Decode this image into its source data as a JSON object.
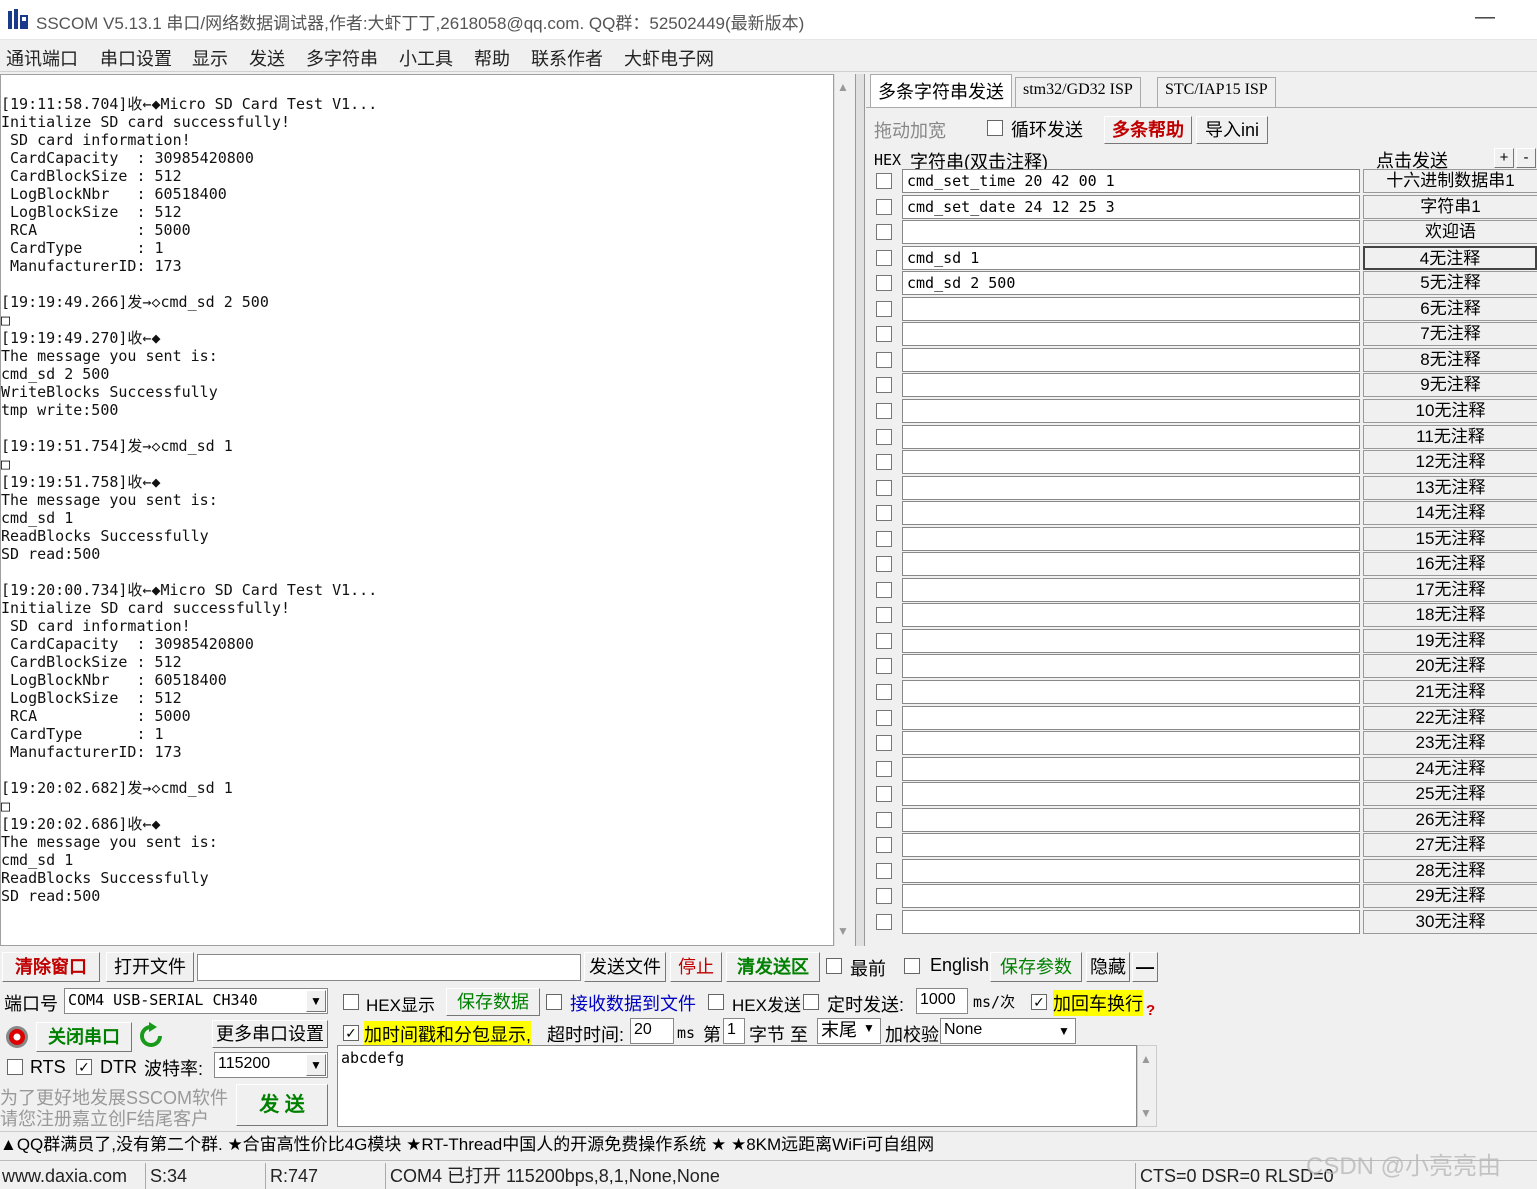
{
  "window": {
    "title": "SSCOM V5.13.1 串口/网络数据调试器,作者:大虾丁丁,2618058@qq.com. QQ群：52502449(最新版本)",
    "minimize_glyph": "—"
  },
  "menu": [
    "通讯端口",
    "串口设置",
    "显示",
    "发送",
    "多字符串",
    "小工具",
    "帮助",
    "联系作者",
    "大虾电子网"
  ],
  "receive_log": "[19:11:58.704]收←◆Micro SD Card Test V1...\nInitialize SD card successfully!\n SD card information!\n CardCapacity  : 30985420800\n CardBlockSize : 512\n LogBlockNbr   : 60518400\n LogBlockSize  : 512\n RCA           : 5000\n CardType      : 1\n ManufacturerID: 173\n\n[19:19:49.266]发→◇cmd_sd 2 500\n□\n[19:19:49.270]收←◆\nThe message you sent is:\ncmd_sd 2 500\nWriteBlocks Successfully\ntmp write:500\n\n[19:19:51.754]发→◇cmd_sd 1\n□\n[19:19:51.758]收←◆\nThe message you sent is:\ncmd_sd 1\nReadBlocks Successfully\nSD read:500\n\n[19:20:00.734]收←◆Micro SD Card Test V1...\nInitialize SD card successfully!\n SD card information!\n CardCapacity  : 30985420800\n CardBlockSize : 512\n LogBlockNbr   : 60518400\n LogBlockSize  : 512\n RCA           : 5000\n CardType      : 1\n ManufacturerID: 173\n\n[19:20:02.682]发→◇cmd_sd 1\n□\n[19:20:02.686]收←◆\nThe message you sent is:\ncmd_sd 1\nReadBlocks Successfully\nSD read:500",
  "tabs": [
    "多条字符串发送",
    "stm32/GD32 ISP",
    "STC/IAP15 ISP"
  ],
  "multi": {
    "drag_label": "拖动加宽",
    "loop_send_label": "循环发送",
    "help_label": "多条帮助",
    "import_label": "导入ini",
    "hex_header": "HEX",
    "string_header": "字符串(双击注释)",
    "click_send_header": "点击发送",
    "plus": "+",
    "minus": "-",
    "rows": [
      {
        "value": "cmd_set_time 20 42 00 1",
        "button": "十六进制数据串1"
      },
      {
        "value": "cmd_set_date 24 12 25 3",
        "button": "字符串1"
      },
      {
        "value": "",
        "button": "欢迎语"
      },
      {
        "value": "cmd_sd 1",
        "button": "4无注释"
      },
      {
        "value": "cmd_sd 2 500",
        "button": "5无注释"
      },
      {
        "value": "",
        "button": "6无注释"
      },
      {
        "value": "",
        "button": "7无注释"
      },
      {
        "value": "",
        "button": "8无注释"
      },
      {
        "value": "",
        "button": "9无注释"
      },
      {
        "value": "",
        "button": "10无注释"
      },
      {
        "value": "",
        "button": "11无注释"
      },
      {
        "value": "",
        "button": "12无注释"
      },
      {
        "value": "",
        "button": "13无注释"
      },
      {
        "value": "",
        "button": "14无注释"
      },
      {
        "value": "",
        "button": "15无注释"
      },
      {
        "value": "",
        "button": "16无注释"
      },
      {
        "value": "",
        "button": "17无注释"
      },
      {
        "value": "",
        "button": "18无注释"
      },
      {
        "value": "",
        "button": "19无注释"
      },
      {
        "value": "",
        "button": "20无注释"
      },
      {
        "value": "",
        "button": "21无注释"
      },
      {
        "value": "",
        "button": "22无注释"
      },
      {
        "value": "",
        "button": "23无注释"
      },
      {
        "value": "",
        "button": "24无注释"
      },
      {
        "value": "",
        "button": "25无注释"
      },
      {
        "value": "",
        "button": "26无注释"
      },
      {
        "value": "",
        "button": "27无注释"
      },
      {
        "value": "",
        "button": "28无注释"
      },
      {
        "value": "",
        "button": "29无注释"
      },
      {
        "value": "",
        "button": "30无注释"
      }
    ]
  },
  "toolbar": {
    "clear_window": "清除窗口",
    "open_file": "打开文件",
    "file_path": "",
    "send_file": "发送文件",
    "stop": "停止",
    "clear_send": "清发送区",
    "topmost": "最前",
    "english": "English",
    "save_params": "保存参数",
    "hide": "隐藏",
    "collapse": "—"
  },
  "port": {
    "port_label": "端口号",
    "port_value": "COM4 USB-SERIAL CH340",
    "close_port": "关闭串口",
    "more_settings": "更多串口设置",
    "rts": "RTS",
    "dtr": "DTR",
    "baud_label": "波特率:",
    "baud_value": "115200",
    "promo_line1": "为了更好地发展SSCOM软件",
    "promo_line2": "请您注册嘉立创F结尾客户",
    "send": "发  送"
  },
  "options": {
    "hex_display": "HEX显示",
    "save_data": "保存数据",
    "recv_to_file": "接收数据到文件",
    "hex_send": "HEX发送",
    "timed_send": "定时发送:",
    "interval": "1000",
    "interval_unit": "ms/次",
    "append_crlf": "加回车换行",
    "timestamp": "加时间戳和分包显示,",
    "timeout_label": "超时时间:",
    "timeout": "20",
    "timeout_unit": "ms",
    "nth_label": "第",
    "nth": "1",
    "byte_to": "字节 至",
    "end": "末尾",
    "checksum_label": "加校验",
    "checksum": "None"
  },
  "send_text": "abcdefg",
  "marquee": "▲QQ群满员了,没有第二个群. ★合宙高性价比4G模块 ★RT-Thread中国人的开源免费操作系统 ★ ★8KM远距离WiFi可自组网",
  "status": {
    "site": "www.daxia.com",
    "sent": "S:34",
    "received": "R:747",
    "port_state": "COM4 已打开  115200bps,8,1,None,None",
    "lines": "CTS=0 DSR=0 RLSD=0"
  },
  "watermark": "CSDN @小亮亮由"
}
